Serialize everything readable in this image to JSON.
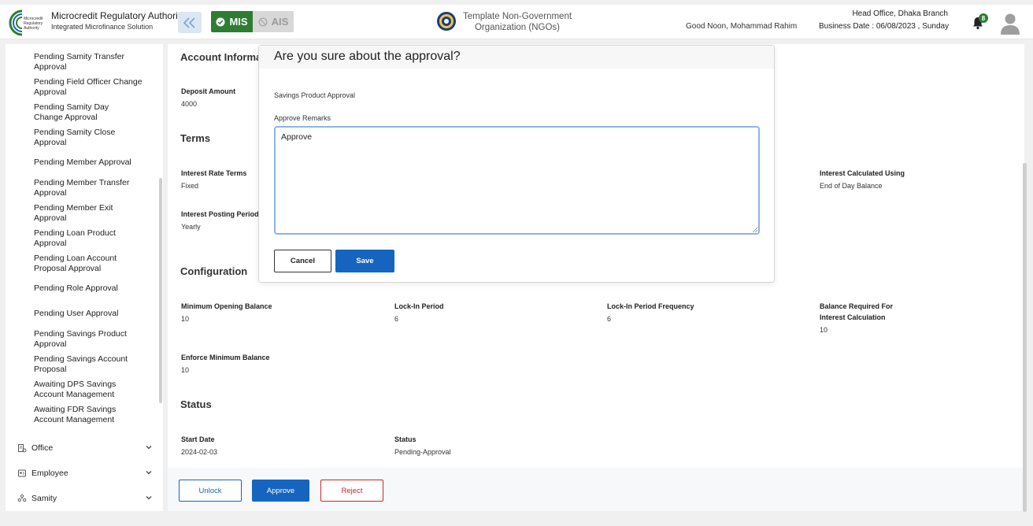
{
  "header": {
    "brand_title": "Microcredit Regulatory Authority",
    "brand_subtitle": "Integrated Microfinance Solution",
    "logo_text": "Microcredit Regulatory Authority",
    "mis_label": "MIS",
    "ais_label": "AIS",
    "org_line1": "Template Non-Government",
    "org_line2": "Organization (NGOs)",
    "greeting": "Good Noon, Mohammad Rahim",
    "branch": "Head Office, Dhaka Branch",
    "business_date": "Business Date : 06/08/2023 , Sunday",
    "notification_count": "8",
    "colors": {
      "mis_green": "#2e7d32",
      "primary_blue": "#1565c0",
      "reject_red": "#c62828"
    }
  },
  "sidebar": {
    "items": [
      "Pending Samity Transfer Approval",
      "Pending Field Officer Change Approval",
      "Pending Samity Day Change Approval",
      "Pending Samity Close Approval",
      "Pending Member Approval",
      "Pending Member Transfer Approval",
      "Pending Member Exit Approval",
      "Pending Loan Product Approval",
      "Pending Loan Account Proposal Approval",
      "Pending Role Approval",
      "Pending User Approval",
      "Pending Savings Product Approval",
      "Pending Savings Account Proposal",
      "Awaiting DPS Savings Account Management",
      "Awaiting FDR Savings Account Management"
    ],
    "groups": [
      "Office",
      "Employee",
      "Samity"
    ]
  },
  "main": {
    "account_info_title": "Account Informa",
    "deposit_amount_label": "Deposit Amount",
    "deposit_amount_value": "4000",
    "terms_title": "Terms",
    "interest_rate_terms_label": "Interest Rate Terms",
    "interest_rate_terms_value": "Fixed",
    "interest_calc_using_label": "Interest Calculated Using",
    "interest_calc_using_value": "End of Day Balance",
    "interest_posting_period_label": "Interest Posting Period",
    "interest_posting_period_value": "Yearly",
    "configuration_title": "Configuration",
    "min_opening_balance_label": "Minimum Opening Balance",
    "min_opening_balance_value": "10",
    "lockin_period_label": "Lock-In Period",
    "lockin_period_value": "6",
    "lockin_freq_label": "Lock-In Period Frequency",
    "lockin_freq_value": "6",
    "balance_required_label_1": "Balance Required For",
    "balance_required_label_2": "Interest Calculation",
    "balance_required_value": "10",
    "enforce_min_balance_label": "Enforce Minimum Balance",
    "enforce_min_balance_value": "10",
    "status_title": "Status",
    "start_date_label": "Start Date",
    "start_date_value": "2024-02-03",
    "status_label": "Status",
    "status_value": "Pending-Approval"
  },
  "footer": {
    "unlock_label": "Unlock",
    "approve_label": "Approve",
    "reject_label": "Reject"
  },
  "modal": {
    "title": "Are you sure about the approval?",
    "subtitle": "Savings Product Approval",
    "remarks_label": "Approve Remarks",
    "remarks_value": "Approve",
    "cancel_label": "Cancel",
    "save_label": "Save"
  }
}
